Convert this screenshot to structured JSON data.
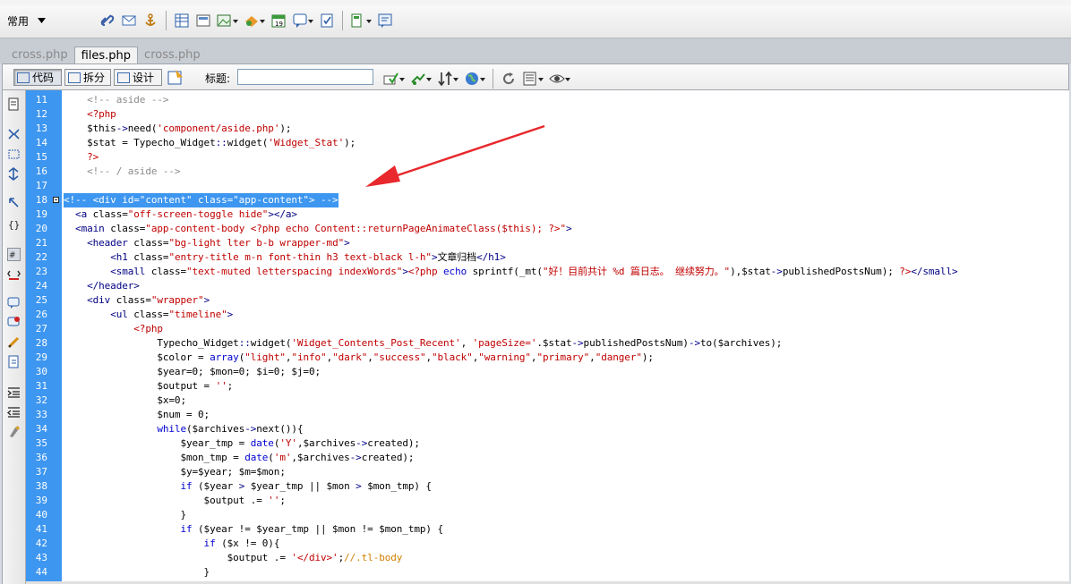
{
  "toolbar1": {
    "mode_label": "常用",
    "icons": [
      "hyperlink-icon",
      "email-link-icon",
      "named-anchor-icon",
      "table-icon",
      "div-icon",
      "image-icon",
      "media-icon",
      "date-icon",
      "comment-icon",
      "template-icon",
      "tag-chooser-icon"
    ]
  },
  "tabs": [
    {
      "label": "cross.php",
      "active": false
    },
    {
      "label": "files.php",
      "active": true
    },
    {
      "label": "cross.php",
      "active": false
    }
  ],
  "toolbar2": {
    "code_label": "代码",
    "split_label": "拆分",
    "design_label": "设计",
    "title_label": "标题:",
    "title_value": ""
  },
  "colors": {
    "gutter": "#3d96f0",
    "selection": "#3d96f0",
    "arrow": "#e8282d"
  },
  "editor": {
    "line_numbers": [
      "11",
      "12",
      "13",
      "14",
      "15",
      "16",
      "17",
      "18",
      "19",
      "20",
      "21",
      "22",
      "23",
      "24",
      "25",
      "26",
      "27",
      "28",
      "29",
      "30",
      "31",
      "32",
      "33",
      "34",
      "35",
      "36",
      "37",
      "38",
      "39",
      "40",
      "41",
      "42",
      "43",
      "44"
    ],
    "lines": [
      "    <!-- aside -->",
      "    <?php",
      "    $this->need('component/aside.php');",
      "    $stat = Typecho_Widget::widget('Widget_Stat');",
      "    ?>",
      "    <!-- / aside -->",
      "",
      "<!-- <div id=\"content\" class=\"app-content\"> -->",
      "  <a class=\"off-screen-toggle hide\"></a>",
      "  <main class=\"app-content-body <?php echo Content::returnPageAnimateClass($this); ?>\">",
      "    <header class=\"bg-light lter b-b wrapper-md\">",
      "        <h1 class=\"entry-title m-n font-thin h3 text-black l-h\">文章归档</h1>",
      "        <small class=\"text-muted letterspacing indexWords\"><?php echo sprintf(_mt(\"好！目前共计 %d 篇日志。 继续努力。\"),$stat->publishedPostsNum); ?></small>",
      "    </header>",
      "    <div class=\"wrapper\">",
      "        <ul class=\"timeline\">",
      "            <?php",
      "                Typecho_Widget::widget('Widget_Contents_Post_Recent', 'pageSize='.$stat->publishedPostsNum)->to($archives);",
      "                $color = array(\"light\",\"info\",\"dark\",\"success\",\"black\",\"warning\",\"primary\",\"danger\");",
      "                $year=0; $mon=0; $i=0; $j=0;",
      "                $output = '';",
      "                $x=0;",
      "                $num = 0;",
      "                while($archives->next()){",
      "                    $year_tmp = date('Y',$archives->created);",
      "                    $mon_tmp = date('m',$archives->created);",
      "                    $y=$year; $m=$mon;",
      "                    if ($year > $year_tmp || $mon > $mon_tmp) {",
      "                        $output .= '';",
      "                    }",
      "                    if ($year != $year_tmp || $mon != $mon_tmp) {",
      "                        if ($x != 0){",
      "                            $output .= '</div>';//.tl-body",
      "                        }"
    ]
  }
}
